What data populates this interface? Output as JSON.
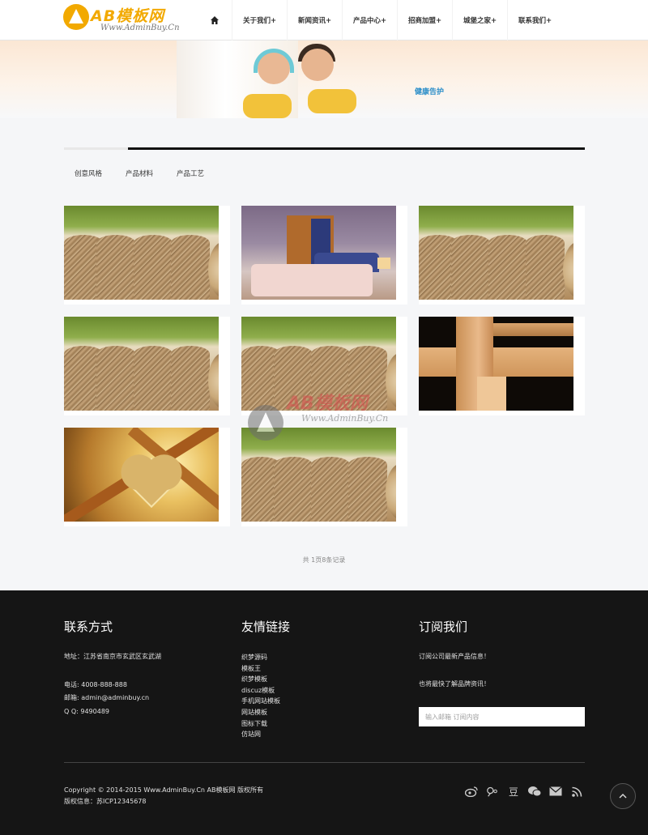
{
  "header": {
    "logo_title": "AB模板网",
    "logo_sub": "Www.AdminBuy.Cn",
    "nav": [
      "关于我们+",
      "新闻资讯+",
      "产品中心+",
      "招商加盟+",
      "城堡之家+",
      "联系我们+"
    ]
  },
  "banner": {
    "tag": "健康告护"
  },
  "tabs": [
    "创意风格",
    "产品材料",
    "产品工艺"
  ],
  "watermark": {
    "title": "AB模板网",
    "sub": "Www.AdminBuy.Cn"
  },
  "pagination": "共 1页8条记录",
  "footer": {
    "contact": {
      "heading": "联系方式",
      "address": "地址：江苏省南京市玄武区玄武湖",
      "phone": "电话: 4008-888-888",
      "email": "邮箱: admin@adminbuy.cn",
      "qq": "Q Q: 9490489"
    },
    "links": {
      "heading": "友情链接",
      "items": [
        "织梦源码",
        "模板王",
        "织梦模板",
        "discuz模板",
        "手机网站模板",
        "网站模板",
        "图标下载",
        "仿站网"
      ]
    },
    "subscribe": {
      "heading": "订阅我们",
      "line1": "订阅公司最新产品信息！",
      "line2": "也将最快了解品牌资讯！",
      "placeholder": "输入邮箱 订阅内容"
    },
    "copyright": "Copyright © 2014-2015 Www.AdminBuy.Cn AB模板网 版权所有",
    "icp": "版权信息：苏ICP12345678",
    "social_icons": [
      "weibo-icon",
      "tencent-weibo-icon",
      "douban-icon",
      "wechat-icon",
      "mail-icon",
      "rss-icon"
    ]
  }
}
